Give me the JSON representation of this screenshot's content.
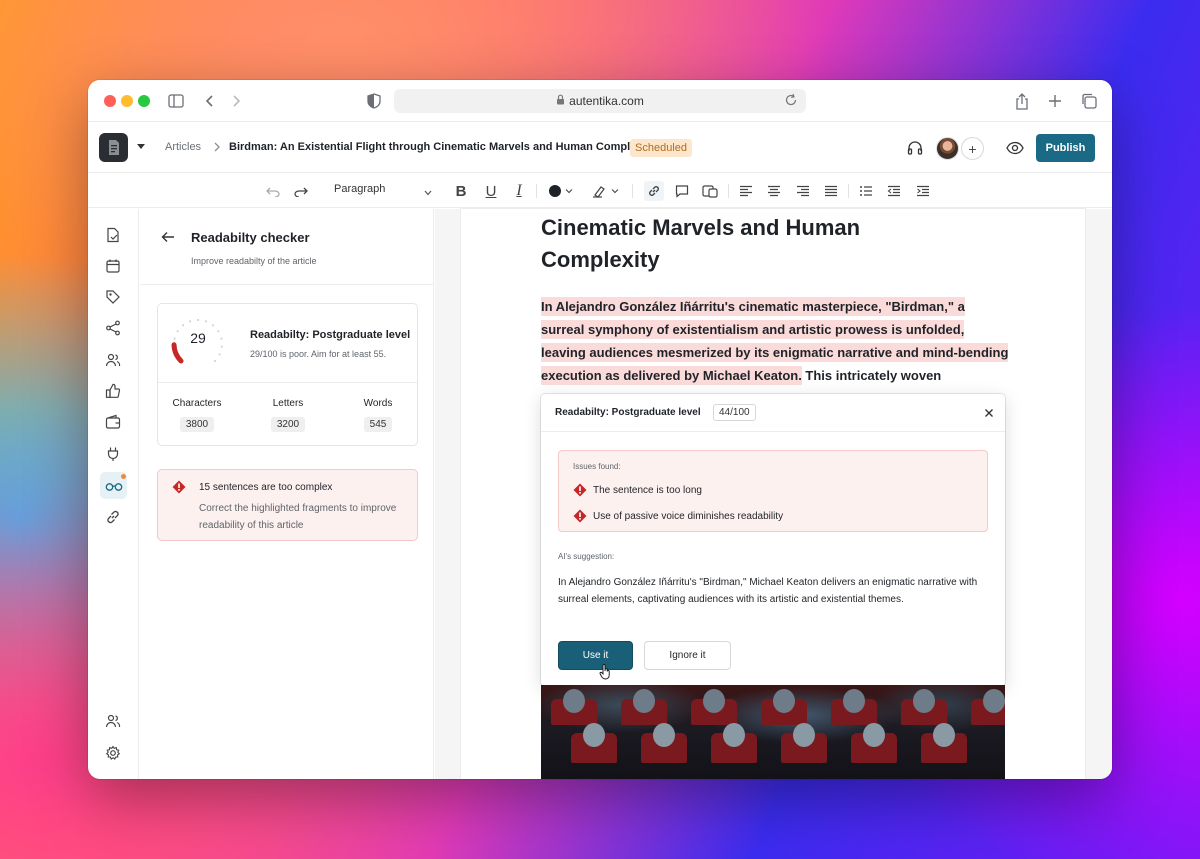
{
  "browser": {
    "url": "autentika.com"
  },
  "header": {
    "breadcrumb_root": "Articles",
    "article_title": "Birdman: An Existential Flight through Cinematic Marvels and Human Complexity",
    "status_badge": "Scheduled",
    "publish_label": "Publish"
  },
  "toolbar": {
    "block_style": "Paragraph"
  },
  "panel": {
    "title": "Readabilty checker",
    "subtitle": "Improve readabilty of the article",
    "score": "29",
    "score_value": 29,
    "score_max": 100,
    "level": "Readabilty: Postgraduate level",
    "note": "29/100 is poor. Aim for at least 55.",
    "stats": [
      {
        "label": "Characters",
        "value": "3800"
      },
      {
        "label": "Letters",
        "value": "3200"
      },
      {
        "label": "Words",
        "value": "545"
      }
    ],
    "issue": {
      "title": "15 sentences are too complex",
      "desc": "Correct the highlighted fragments to improve readability of this article"
    }
  },
  "editor": {
    "heading": "Cinematic Marvels and Human Complexity",
    "highlighted": "In Alejandro González Iñárritu's cinematic masterpiece, \"Birdman,\" a surreal symphony of existentialism and artistic prowess is unfolded, leaving audiences mesmerized by its enigmatic narrative and mind-bending execution as delivered by Michael Keaton.",
    "rest": " This intricately woven"
  },
  "popup": {
    "level": "Readabilty: Postgraduate level",
    "score": "44/100",
    "issues_label": "Issues found:",
    "issues": [
      "The sentence is too long",
      "Use of passive voice diminishes readability"
    ],
    "suggestion_label": "AI's suggestion:",
    "suggestion": "In Alejandro González Iñárritu's \"Birdman,\" Michael Keaton delivers an enigmatic narrative with surreal elements, captivating audiences with its artistic and existential themes.",
    "use_label": "Use it",
    "ignore_label": "Ignore it"
  },
  "colors": {
    "accent": "#1a6a86",
    "highlight": "#fbdada",
    "warning": "#c62828",
    "badge_bg": "#fde7cc"
  }
}
